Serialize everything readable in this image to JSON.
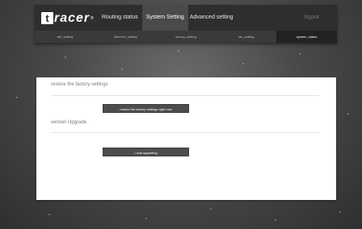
{
  "header": {
    "logo": {
      "letter": "t",
      "word": "racer",
      "reg": "®"
    },
    "nav": [
      {
        "label": "Routing status",
        "active": false
      },
      {
        "label": "System Setting",
        "active": true
      },
      {
        "label": "Advanced setting",
        "active": false
      }
    ],
    "logout": "logout"
  },
  "subnav": [
    {
      "label": "wifi_setting",
      "active": false
    },
    {
      "label": "ethernet_setting",
      "active": false
    },
    {
      "label": "secury_setting",
      "active": false
    },
    {
      "label": "lan_setting",
      "active": false
    },
    {
      "label": "system_status",
      "active": true
    }
  ],
  "main": {
    "factory_title": "restore the factory settings",
    "factory_button": "restore the factory settings right now",
    "upgrade_title": "version Upgrade",
    "upgrade_button": "Local upgrading"
  },
  "colors": {
    "header_bg": "#2e2e2e",
    "nav_active_bg": "#4a4a4a",
    "subnav_bg": "#3a3a3a",
    "subnav_active_bg": "#222222",
    "button_bg": "#4d4d4d"
  }
}
